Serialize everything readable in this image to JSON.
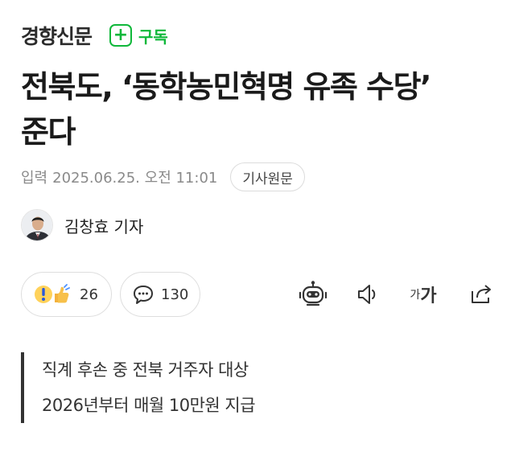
{
  "press": {
    "name": "경향신문",
    "subscribe_icon": "plus-square-icon",
    "subscribe_label": "구독"
  },
  "article": {
    "headline_line1": "전북도, ‘동학농민혁명 유족 수당’",
    "headline_line2": "준다",
    "input_label": "입력",
    "input_date": "2025.06.25. 오전 11:01",
    "original_button": "기사원문",
    "reporter": "김창효 기자"
  },
  "actions": {
    "reaction_count": "26",
    "comment_count": "130",
    "tools": [
      "robot-summary-icon",
      "speaker-icon",
      "font-size-icon",
      "share-icon"
    ],
    "font_small": "가",
    "font_big": "가"
  },
  "summary": {
    "lines": [
      "직계 후손 중 전북 거주자 대상",
      "2026년부터 매월 10만원 지급"
    ]
  },
  "colors": {
    "brand_green": "#0fb83a",
    "text": "#1a1a1a",
    "muted": "#8a8a8a"
  }
}
